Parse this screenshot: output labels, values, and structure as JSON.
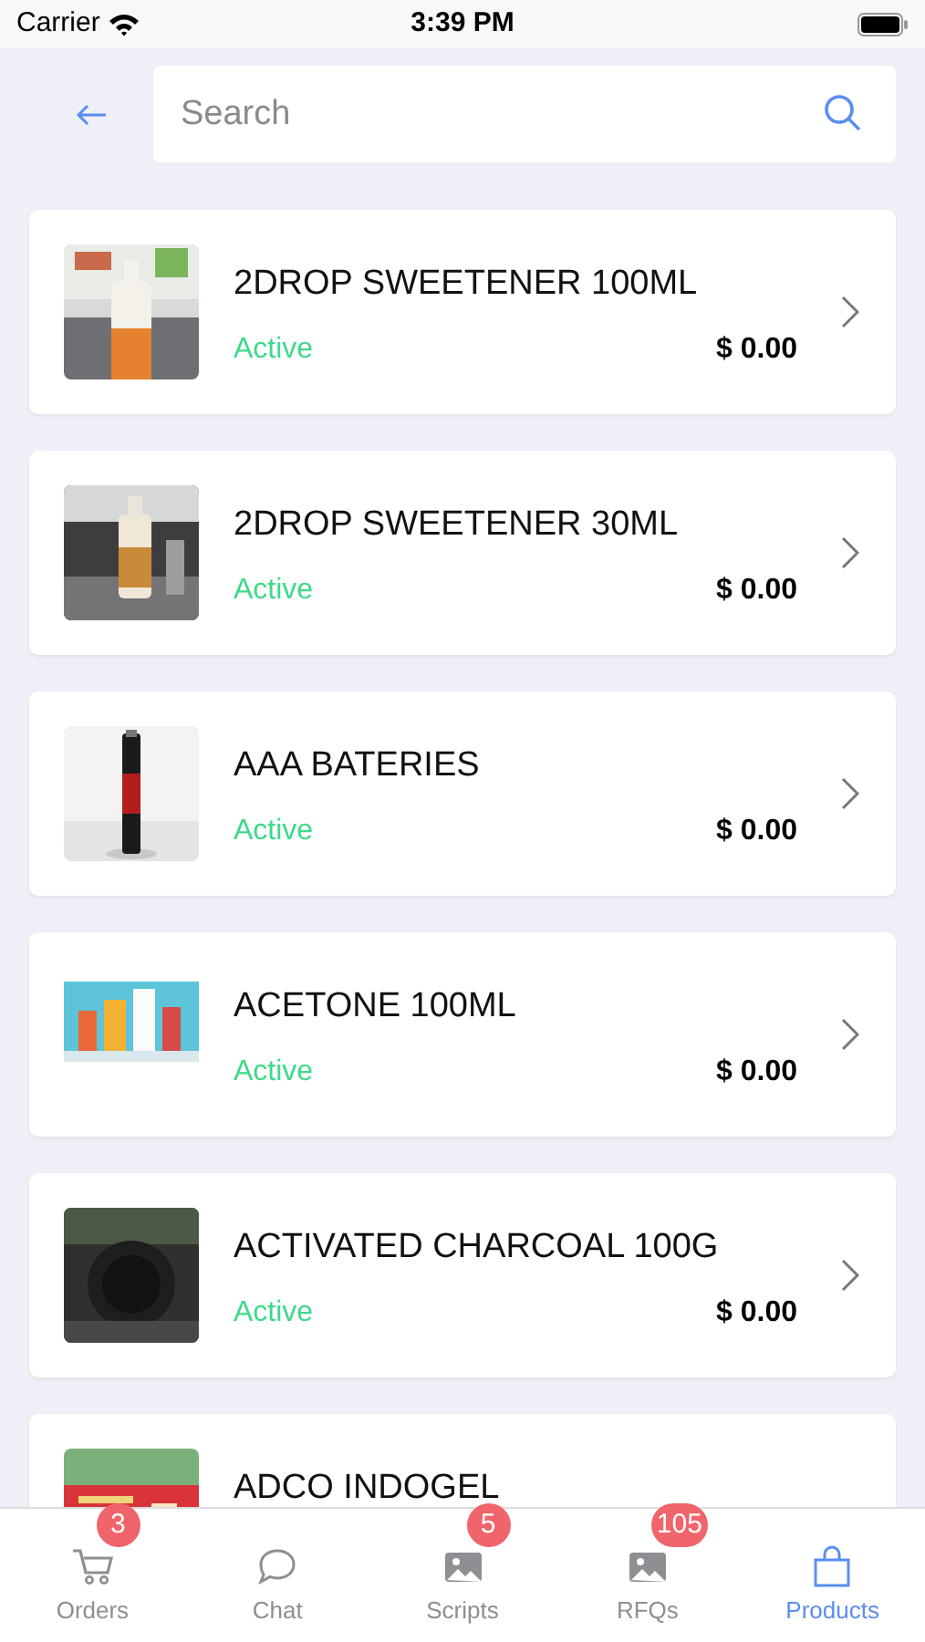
{
  "status_bar": {
    "carrier": "Carrier",
    "time": "3:39 PM"
  },
  "search": {
    "placeholder": "Search"
  },
  "products": [
    {
      "name": "2DROP SWEETENER 100ML",
      "status": "Active",
      "price": "$ 0.00"
    },
    {
      "name": "2DROP SWEETENER 30ML",
      "status": "Active",
      "price": "$ 0.00"
    },
    {
      "name": "AAA BATERIES",
      "status": "Active",
      "price": "$ 0.00"
    },
    {
      "name": "ACETONE 100ML",
      "status": "Active",
      "price": "$ 0.00"
    },
    {
      "name": "ACTIVATED CHARCOAL 100G",
      "status": "Active",
      "price": "$ 0.00"
    },
    {
      "name": "ADCO INDOGEL"
    }
  ],
  "tab_bar": [
    {
      "label": "Orders",
      "badge": "3",
      "selected": false
    },
    {
      "label": "Chat",
      "selected": false
    },
    {
      "label": "Scripts",
      "badge": "5",
      "selected": false
    },
    {
      "label": "RFQs",
      "badge": "105",
      "selected": false
    },
    {
      "label": "Products",
      "selected": true
    }
  ]
}
